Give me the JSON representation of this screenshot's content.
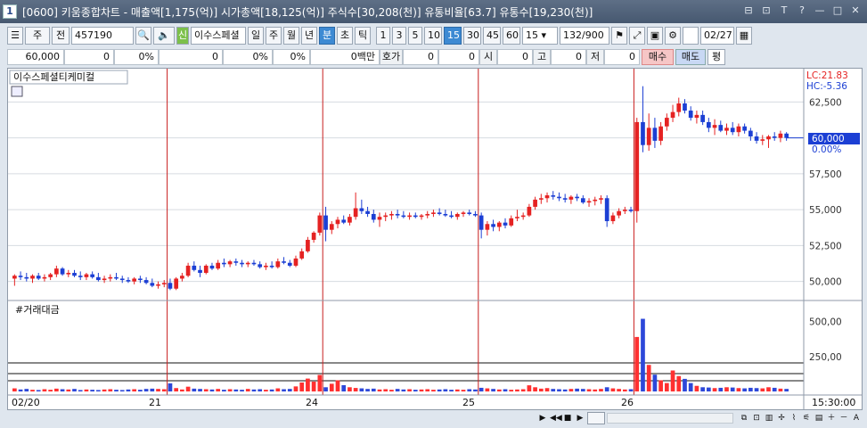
{
  "window": {
    "num": "1",
    "title": "[0600] 키움종합차트 - 매출액[1,175(억)] 시가총액[18,125(억)] 주식수[30,208(천)] 유통비율[63.7] 유통수[19,230(천)]",
    "controls": [
      "⊟",
      "⊡",
      "T",
      "?",
      "—",
      "□",
      "✕"
    ]
  },
  "toolbar": {
    "icons": [
      "📋",
      "🔍",
      "🔊",
      "⚙"
    ],
    "mode": "주",
    "whole": "전",
    "code": "457190",
    "credit": "신",
    "name": "이수스페셜",
    "periods": [
      "일",
      "주",
      "월",
      "년",
      "분",
      "초",
      "틱"
    ],
    "periods_selected": "분",
    "intervals": [
      "1",
      "3",
      "5",
      "10",
      "15",
      "30",
      "45",
      "60"
    ],
    "intervals_selected": "15",
    "interval_value": "15",
    "count": "132/900",
    "date": "02/27"
  },
  "quote": {
    "price": "60,000",
    "change": "0",
    "change_pct": "0%",
    "vol": "0",
    "vol_pct": "0%",
    "vol2_pct": "0%",
    "amount": "0백만",
    "hoga_label": "호가",
    "hoga1": "0",
    "hoga2": "0",
    "open_label": "시",
    "open": "0",
    "high_label": "고",
    "high": "0",
    "low_label": "저",
    "low": "0",
    "buy": "매수",
    "sell": "매도",
    "avg": "평"
  },
  "colors": {
    "up": "#e52222",
    "down": "#1c3fd4",
    "bar_up": "#ff3030",
    "bar_down": "#2d48d9",
    "divider": "#c81e1e"
  },
  "chart_data": {
    "type": "candlestick",
    "title": "이수스페셜티케미컬",
    "lc_label": "LC:21.83",
    "hc_label": "HC:-5.36",
    "current_price_label": "60,000",
    "current_change_label": "0.00%",
    "ylim": [
      48800,
      64200
    ],
    "yticks": [
      62500,
      60000,
      57500,
      55000,
      52500,
      50000
    ],
    "ytick_labels": [
      "62,500",
      "60,000",
      "57,500",
      "55,000",
      "52,500",
      "50,000"
    ],
    "volume_title": "#거래대금",
    "volume_ylim": [
      0,
      600
    ],
    "volume_yticks": [
      500,
      250
    ],
    "volume_ytick_labels": [
      "500,00",
      "250,00"
    ],
    "x_labels": [
      "02/20",
      "21",
      "24",
      "25",
      "26"
    ],
    "time_label": "15:30:00",
    "day_starts": [
      0,
      26,
      52,
      78,
      104
    ],
    "candles": [
      [
        50200,
        50500,
        49700,
        50400
      ],
      [
        50400,
        50700,
        50100,
        50300
      ],
      [
        50300,
        50600,
        50000,
        50200
      ],
      [
        50200,
        50500,
        49900,
        50400
      ],
      [
        50400,
        50600,
        50100,
        50200
      ],
      [
        50200,
        50500,
        50000,
        50300
      ],
      [
        50300,
        50600,
        50100,
        50500
      ],
      [
        50500,
        51100,
        50300,
        50900
      ],
      [
        50900,
        51000,
        50400,
        50500
      ],
      [
        50500,
        50800,
        50300,
        50600
      ],
      [
        50600,
        50800,
        50300,
        50400
      ],
      [
        50400,
        50700,
        50100,
        50300
      ],
      [
        50300,
        50600,
        50100,
        50500
      ],
      [
        50500,
        50700,
        50200,
        50300
      ],
      [
        50300,
        50600,
        50000,
        50100
      ],
      [
        50100,
        50400,
        49900,
        50200
      ],
      [
        50200,
        50500,
        50000,
        50300
      ],
      [
        50300,
        50600,
        50100,
        50200
      ],
      [
        50200,
        50400,
        49900,
        50100
      ],
      [
        50100,
        50300,
        49900,
        50000
      ],
      [
        50000,
        50300,
        49800,
        50200
      ],
      [
        50200,
        50400,
        49900,
        50100
      ],
      [
        50100,
        50300,
        49800,
        49900
      ],
      [
        49900,
        50200,
        49600,
        49700
      ],
      [
        49700,
        50000,
        49500,
        49800
      ],
      [
        49800,
        50100,
        49600,
        49900
      ],
      [
        49900,
        50200,
        49400,
        49500
      ],
      [
        49500,
        50300,
        49400,
        50200
      ],
      [
        50200,
        50600,
        50000,
        50400
      ],
      [
        50400,
        51300,
        50300,
        51100
      ],
      [
        51100,
        51400,
        50700,
        50800
      ],
      [
        50800,
        51100,
        50300,
        50600
      ],
      [
        50600,
        51200,
        50500,
        51100
      ],
      [
        51100,
        51300,
        50800,
        50900
      ],
      [
        50900,
        51500,
        50800,
        51300
      ],
      [
        51300,
        51600,
        51000,
        51200
      ],
      [
        51200,
        51500,
        51000,
        51400
      ],
      [
        51400,
        51600,
        51100,
        51300
      ],
      [
        51300,
        51500,
        51000,
        51200
      ],
      [
        51200,
        51400,
        51000,
        51300
      ],
      [
        51300,
        51500,
        51100,
        51200
      ],
      [
        51200,
        51400,
        50900,
        51000
      ],
      [
        51000,
        51300,
        50800,
        51100
      ],
      [
        51100,
        51400,
        50900,
        51000
      ],
      [
        51000,
        51600,
        50900,
        51400
      ],
      [
        51400,
        51700,
        51200,
        51300
      ],
      [
        51300,
        51500,
        51000,
        51100
      ],
      [
        51100,
        51800,
        51000,
        51600
      ],
      [
        51600,
        52300,
        51500,
        52100
      ],
      [
        52100,
        53100,
        52000,
        52900
      ],
      [
        52900,
        53500,
        52700,
        53400
      ],
      [
        53400,
        54800,
        53200,
        54600
      ],
      [
        54600,
        55200,
        52800,
        53600
      ],
      [
        53600,
        54200,
        53300,
        54000
      ],
      [
        54000,
        54500,
        53700,
        54300
      ],
      [
        54300,
        54600,
        54000,
        54100
      ],
      [
        54100,
        54700,
        53900,
        54500
      ],
      [
        54500,
        56200,
        54300,
        55100
      ],
      [
        55100,
        55700,
        54700,
        54900
      ],
      [
        54900,
        55200,
        54500,
        54700
      ],
      [
        54700,
        55000,
        54100,
        54300
      ],
      [
        54300,
        54800,
        53800,
        54500
      ],
      [
        54500,
        54800,
        54200,
        54600
      ],
      [
        54600,
        54900,
        54300,
        54700
      ],
      [
        54700,
        55000,
        54400,
        54600
      ],
      [
        54600,
        54900,
        54400,
        54500
      ],
      [
        54500,
        54800,
        54300,
        54600
      ],
      [
        54600,
        54800,
        54400,
        54500
      ],
      [
        54500,
        54700,
        54300,
        54600
      ],
      [
        54600,
        54900,
        54400,
        54700
      ],
      [
        54700,
        55000,
        54500,
        54800
      ],
      [
        54800,
        55100,
        54600,
        54700
      ],
      [
        54700,
        55000,
        54500,
        54600
      ],
      [
        54600,
        54900,
        54400,
        54500
      ],
      [
        54500,
        54800,
        54300,
        54700
      ],
      [
        54700,
        54900,
        54500,
        54800
      ],
      [
        54800,
        55000,
        54600,
        54700
      ],
      [
        54700,
        54900,
        54500,
        54600
      ],
      [
        54600,
        54800,
        53000,
        53600
      ],
      [
        53600,
        54200,
        53200,
        54000
      ],
      [
        54000,
        54300,
        53500,
        53800
      ],
      [
        53800,
        54200,
        53500,
        54100
      ],
      [
        54100,
        54400,
        53700,
        53900
      ],
      [
        53900,
        54600,
        53800,
        54400
      ],
      [
        54400,
        55000,
        54200,
        54500
      ],
      [
        54500,
        54800,
        54300,
        54600
      ],
      [
        54600,
        55400,
        54500,
        55200
      ],
      [
        55200,
        55900,
        55000,
        55700
      ],
      [
        55700,
        56100,
        55400,
        55800
      ],
      [
        55800,
        56200,
        55500,
        56000
      ],
      [
        56000,
        56300,
        55700,
        55900
      ],
      [
        55900,
        56200,
        55600,
        55800
      ],
      [
        55800,
        56100,
        55500,
        55700
      ],
      [
        55700,
        56000,
        55400,
        55900
      ],
      [
        55900,
        56100,
        55600,
        55800
      ],
      [
        55800,
        56000,
        55400,
        55500
      ],
      [
        55500,
        55800,
        55200,
        55600
      ],
      [
        55600,
        55900,
        55300,
        55700
      ],
      [
        55700,
        56000,
        55400,
        55800
      ],
      [
        55800,
        56000,
        53800,
        54200
      ],
      [
        54200,
        54800,
        54000,
        54600
      ],
      [
        54600,
        55100,
        54400,
        54900
      ],
      [
        54900,
        55200,
        54700,
        55000
      ],
      [
        55000,
        55200,
        54800,
        54900
      ],
      [
        54900,
        61400,
        54100,
        61100
      ],
      [
        61100,
        63600,
        59000,
        59500
      ],
      [
        59500,
        61700,
        59100,
        60700
      ],
      [
        60700,
        61400,
        59300,
        59800
      ],
      [
        59800,
        61100,
        59500,
        60800
      ],
      [
        60800,
        61700,
        60500,
        61400
      ],
      [
        61400,
        62300,
        61100,
        61800
      ],
      [
        61800,
        62800,
        61500,
        62400
      ],
      [
        62400,
        62700,
        61700,
        61900
      ],
      [
        61900,
        62200,
        61200,
        61400
      ],
      [
        61400,
        61900,
        61000,
        61600
      ],
      [
        61600,
        61900,
        60900,
        61100
      ],
      [
        61100,
        61400,
        60400,
        60700
      ],
      [
        60700,
        61300,
        60200,
        60900
      ],
      [
        60900,
        61200,
        60400,
        60500
      ],
      [
        60500,
        61000,
        60200,
        60700
      ],
      [
        60700,
        61100,
        60200,
        60400
      ],
      [
        60400,
        61000,
        60100,
        60800
      ],
      [
        60800,
        61000,
        60300,
        60500
      ],
      [
        60500,
        60700,
        59800,
        60100
      ],
      [
        60100,
        60400,
        59600,
        59800
      ],
      [
        59800,
        60200,
        59500,
        59900
      ],
      [
        59900,
        60200,
        59300,
        60100
      ],
      [
        60100,
        60400,
        59800,
        60000
      ],
      [
        60000,
        60500,
        59700,
        60300
      ],
      [
        60300,
        60400,
        59800,
        60000
      ]
    ],
    "volumes": [
      22,
      14,
      18,
      12,
      10,
      16,
      12,
      20,
      16,
      14,
      18,
      10,
      14,
      12,
      10,
      14,
      16,
      12,
      10,
      14,
      16,
      12,
      18,
      20,
      18,
      16,
      58,
      24,
      14,
      34,
      20,
      18,
      16,
      14,
      18,
      12,
      16,
      14,
      12,
      18,
      14,
      16,
      12,
      14,
      22,
      16,
      18,
      36,
      64,
      92,
      70,
      118,
      30,
      55,
      80,
      45,
      30,
      25,
      22,
      18,
      20,
      14,
      16,
      12,
      18,
      14,
      16,
      12,
      14,
      16,
      12,
      14,
      16,
      12,
      14,
      12,
      16,
      14,
      26,
      22,
      18,
      14,
      16,
      12,
      14,
      16,
      44,
      30,
      20,
      24,
      18,
      16,
      14,
      18,
      20,
      18,
      16,
      14,
      18,
      30,
      22,
      18,
      14,
      16,
      390,
      520,
      190,
      120,
      80,
      60,
      150,
      110,
      90,
      60,
      40,
      30,
      28,
      24,
      26,
      30,
      28,
      24,
      22,
      26,
      24,
      22,
      30,
      26,
      20,
      18
    ]
  }
}
